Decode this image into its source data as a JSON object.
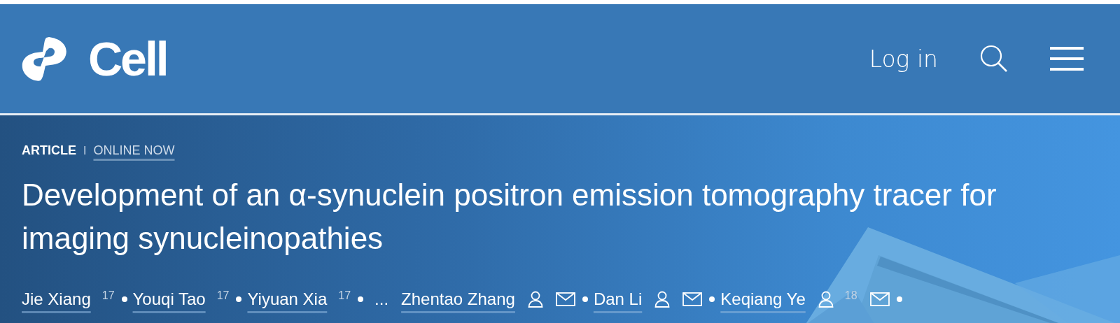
{
  "header": {
    "logo_text": "Cell",
    "login": "Log in"
  },
  "hero": {
    "type_label": "ARTICLE",
    "divider": "I",
    "status": "ONLINE NOW",
    "title": "Development of an α-synuclein positron emission tomography tracer for imaging synucleinopathies",
    "authors": [
      {
        "kind": "author",
        "name": "Jie Xiang",
        "sup": "17",
        "person": false,
        "mail": false
      },
      {
        "kind": "author",
        "name": "Youqi Tao",
        "sup": "17",
        "person": false,
        "mail": false
      },
      {
        "kind": "author",
        "name": "Yiyuan Xia",
        "sup": "17",
        "person": false,
        "mail": false
      },
      {
        "kind": "ellipsis",
        "text": "..."
      },
      {
        "kind": "author",
        "name": "Zhentao Zhang",
        "person": true,
        "mail": true
      },
      {
        "kind": "author",
        "name": "Dan Li",
        "person": true,
        "mail": true
      },
      {
        "kind": "author",
        "name": "Keqiang Ye",
        "sup": "18",
        "person": true,
        "mail": true
      }
    ]
  }
}
